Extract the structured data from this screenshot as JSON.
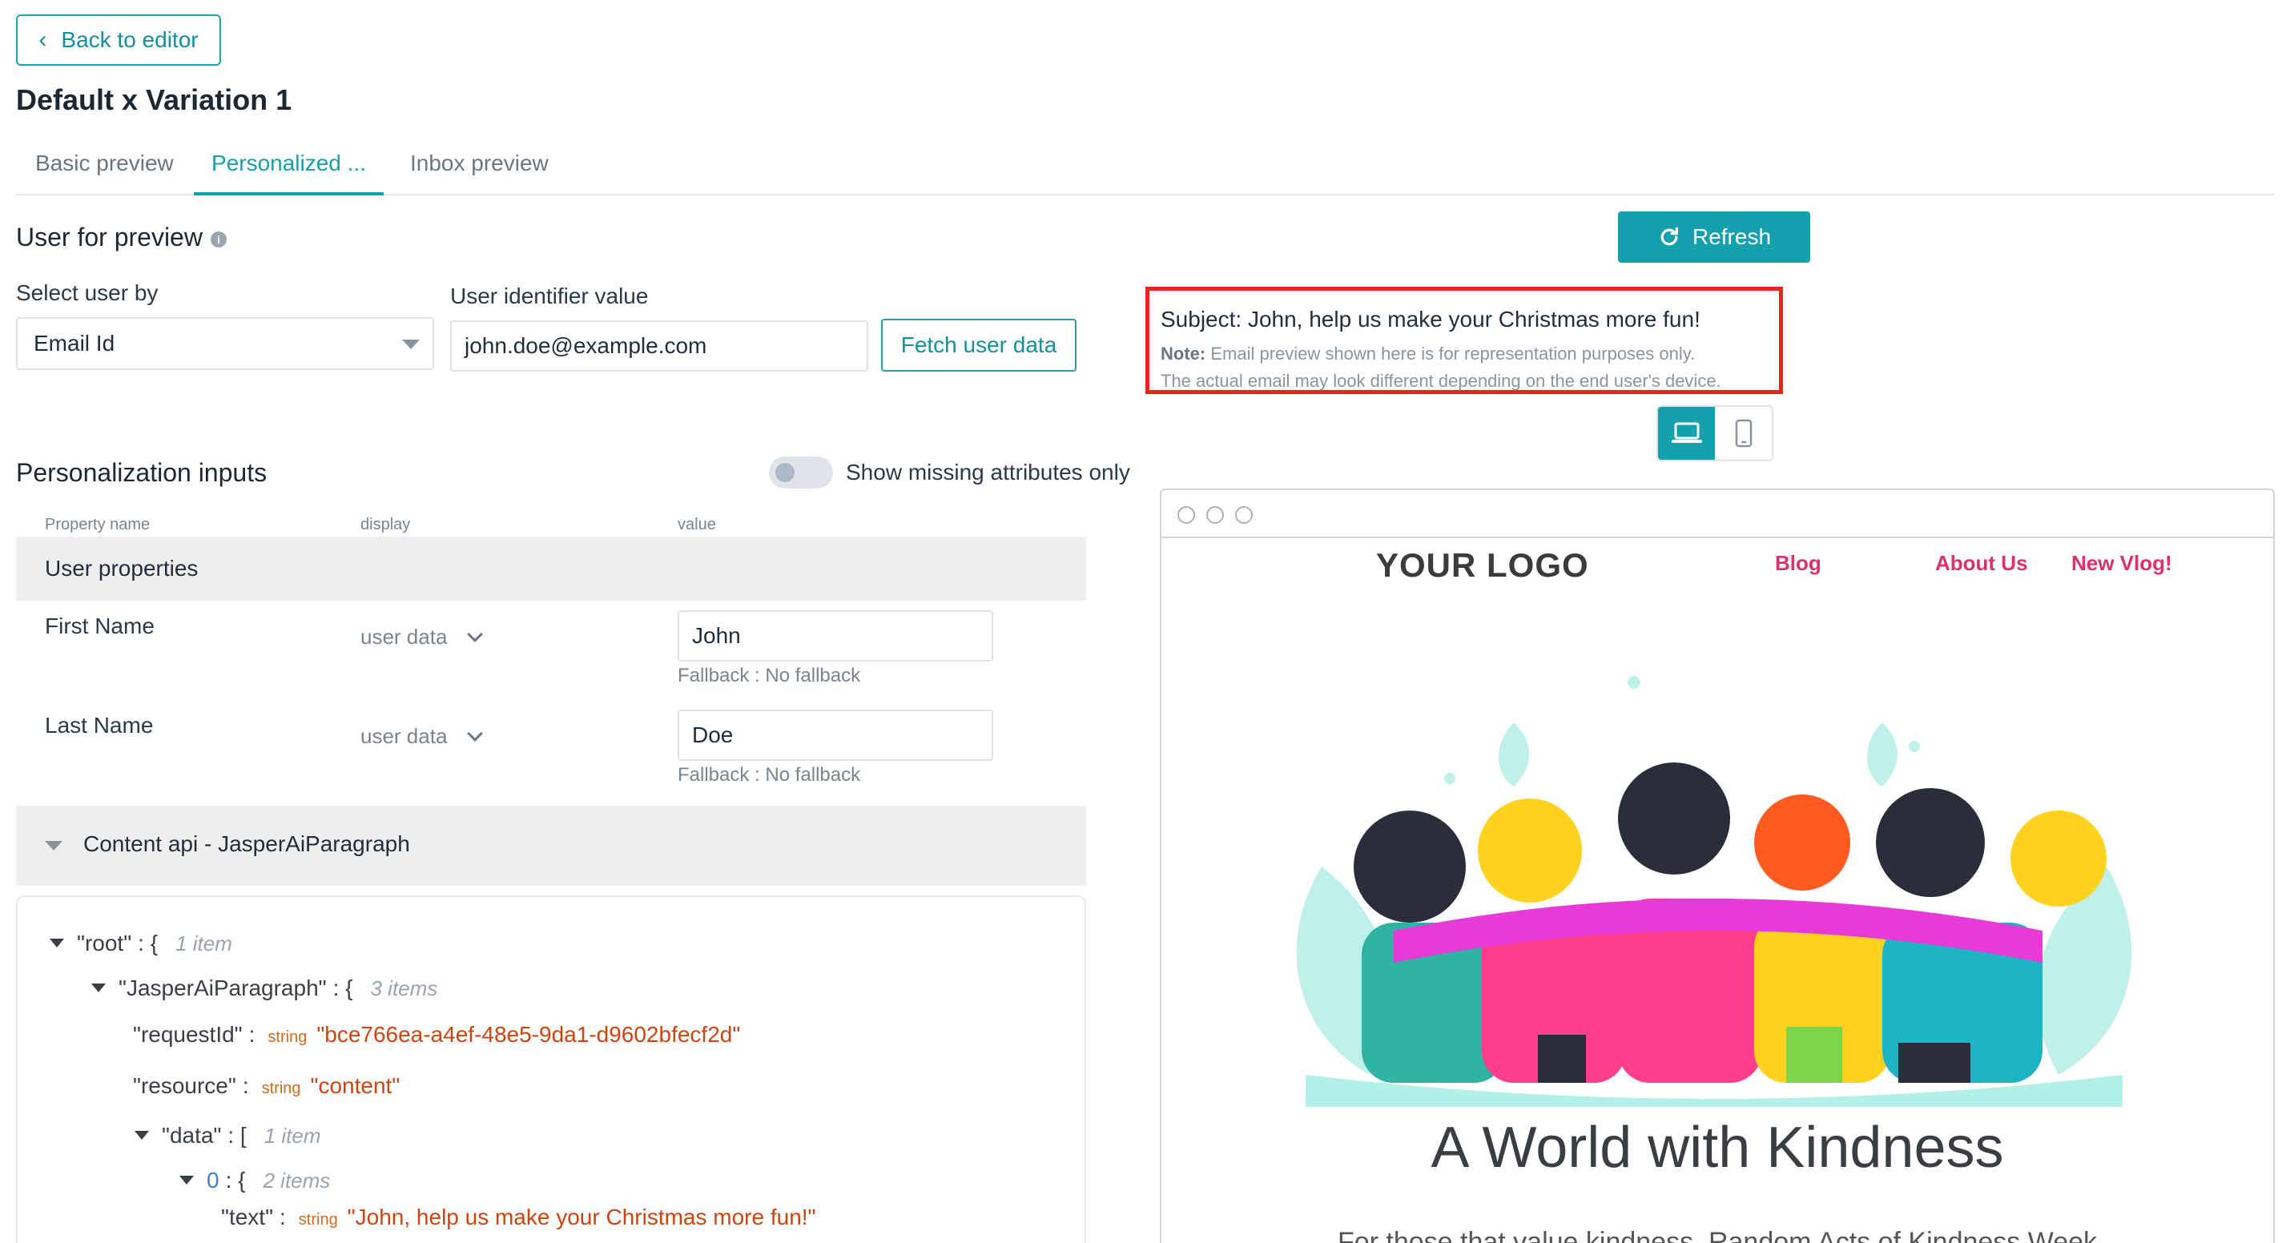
{
  "header": {
    "back_label": "Back to editor",
    "title": "Default x Variation 1"
  },
  "tabs": [
    {
      "label": "Basic preview",
      "active": false
    },
    {
      "label": "Personalized ...",
      "active": true
    },
    {
      "label": "Inbox preview",
      "active": false
    }
  ],
  "user_preview": {
    "title": "User for preview",
    "select_label": "Select user by",
    "select_value": "Email Id",
    "identifier_label": "User identifier value",
    "identifier_value": "john.doe@example.com",
    "fetch_label": "Fetch user data"
  },
  "personalization": {
    "title": "Personalization inputs",
    "toggle_label": "Show missing attributes only",
    "toggle_on": false,
    "columns": [
      "Property name",
      "display",
      "value"
    ],
    "group_title": "User properties",
    "properties": [
      {
        "name": "First Name",
        "display": "user data",
        "value": "John",
        "fallback": "Fallback : No fallback"
      },
      {
        "name": "Last Name",
        "display": "user data",
        "value": "Doe",
        "fallback": "Fallback : No fallback"
      }
    ],
    "api_title": "Content api - JasperAiParagraph"
  },
  "json_tree": {
    "root_key": "\"root\"",
    "root_count": "1 item",
    "jasper_key": "\"JasperAiParagraph\"",
    "jasper_count": "3 items",
    "request_key": "\"requestId\"",
    "request_type": "string",
    "request_value": "\"bce766ea-a4ef-48e5-9da1-d9602bfecf2d\"",
    "resource_key": "\"resource\"",
    "resource_type": "string",
    "resource_value": "\"content\"",
    "data_key": "\"data\"",
    "data_count": "1 item",
    "zero_key": "0",
    "zero_count": "2 items",
    "text_key": "\"text\"",
    "text_type": "string",
    "text_value": "\"John, help us make your Christmas more fun!\""
  },
  "preview": {
    "refresh_label": "Refresh",
    "subject": "Subject: John, help us make your Christmas more fun!",
    "note_label": "Note:",
    "note_line1": "Email preview shown here is for representation purposes only.",
    "note_line2": "The actual email may look different depending on the end user's device.",
    "device_active": "desktop",
    "email": {
      "logo": "YOUR LOGO",
      "nav": [
        "Blog",
        "About Us",
        "New Vlog!"
      ],
      "headline": "A World with Kindness",
      "body_start": "For those that value kindness, Random Acts of Kindness Week"
    }
  },
  "colors": {
    "accent": "#14a0ad",
    "highlight_border": "#e8231c",
    "nav_link": "#e0306b",
    "json_string": "#cc4510"
  }
}
